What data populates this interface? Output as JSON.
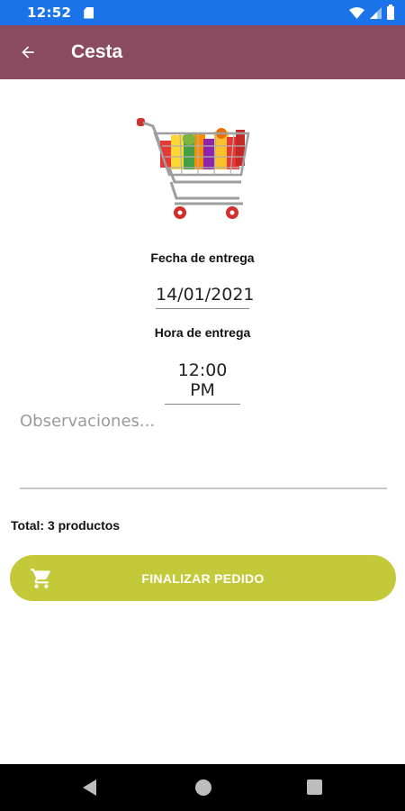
{
  "status_bar": {
    "time": "12:52",
    "icons": [
      "sd-card-icon",
      "wifi-icon",
      "signal-icon",
      "battery-icon"
    ]
  },
  "app_bar": {
    "title": "Cesta",
    "back_icon": "arrow-back-icon",
    "color": "#8a4a5f"
  },
  "delivery": {
    "date_label": "Fecha de entrega",
    "date_value": "14/01/2021",
    "time_label": "Hora de entrega",
    "time_value": "12:00 PM"
  },
  "notes": {
    "placeholder": "Observaciones..."
  },
  "summary": {
    "total_text": "Total: 3 productos"
  },
  "finalize": {
    "label": "FINALIZAR PEDIDO",
    "icon": "shopping-cart-icon",
    "color": "#c4c93a"
  },
  "nav_bar": {
    "icons": [
      "nav-back-icon",
      "nav-home-icon",
      "nav-recents-icon"
    ]
  }
}
